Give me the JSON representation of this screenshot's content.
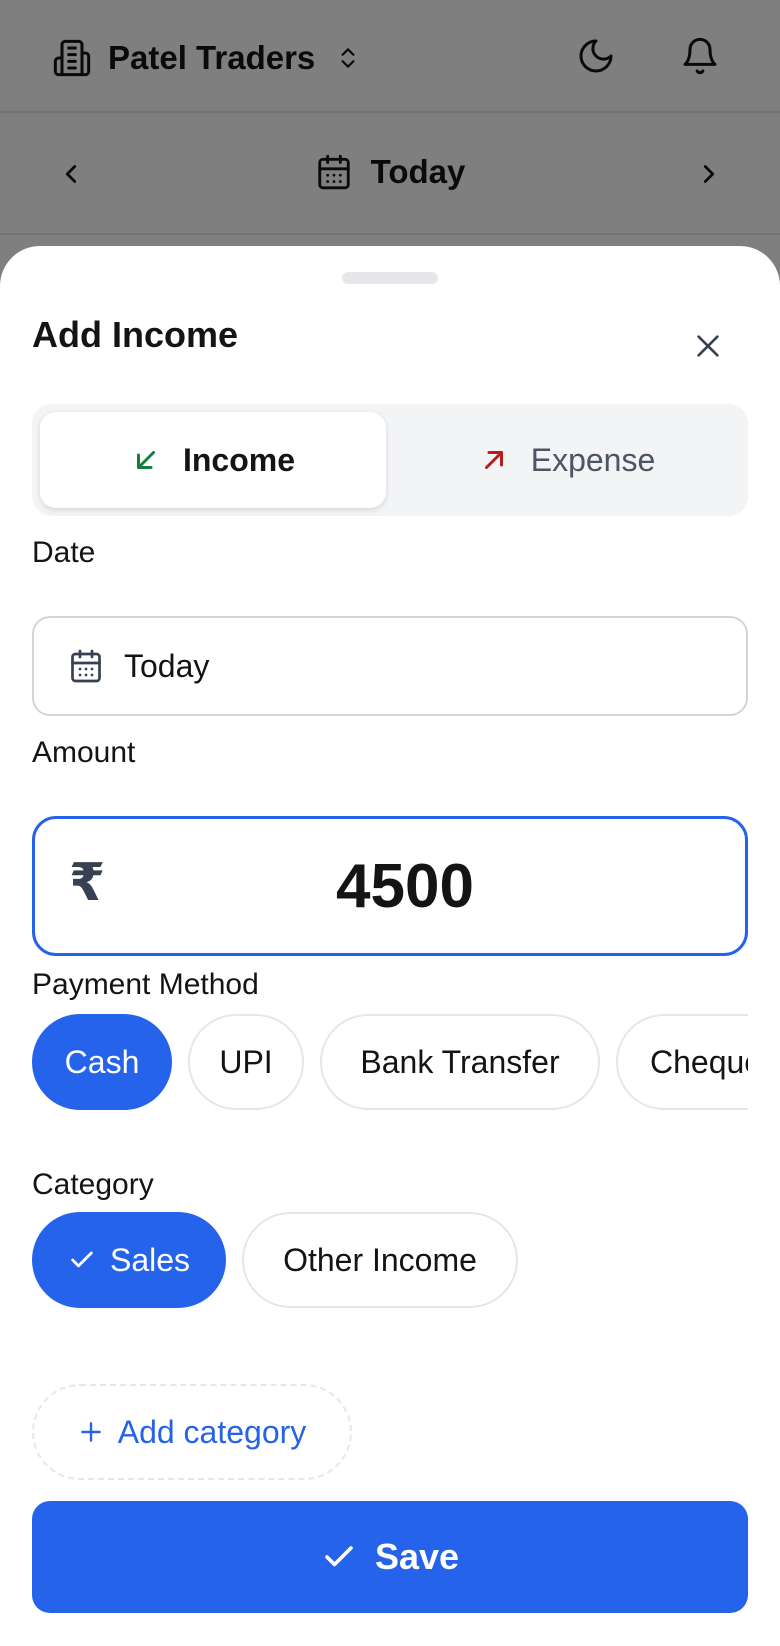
{
  "header": {
    "business_name": "Patel Traders",
    "icons": [
      "building-icon",
      "chevron-up-down-icon",
      "moon-icon",
      "bell-icon"
    ]
  },
  "date_nav": {
    "label": "Today",
    "icons": [
      "chevron-left-icon",
      "calendar-icon",
      "chevron-right-icon"
    ]
  },
  "sheet": {
    "title": "Add Income",
    "type_toggle": {
      "income_label": "Income",
      "expense_label": "Expense",
      "selected": "Income"
    },
    "date": {
      "label": "Date",
      "value": "Today"
    },
    "amount": {
      "label": "Amount",
      "currency_symbol": "₹",
      "value": "4500"
    },
    "payment_method": {
      "label": "Payment Method",
      "options": [
        "Cash",
        "UPI",
        "Bank Transfer",
        "Cheque"
      ],
      "selected": "Cash"
    },
    "category": {
      "label": "Category",
      "options": [
        "Sales",
        "Other Income"
      ],
      "selected": "Sales",
      "add_label": "Add category"
    },
    "save_label": "Save"
  },
  "colors": {
    "primary": "#2563eb",
    "income_arrow": "#15803d",
    "expense_arrow": "#b91c1c",
    "overlay": "rgba(0,0,0,0.5)"
  }
}
